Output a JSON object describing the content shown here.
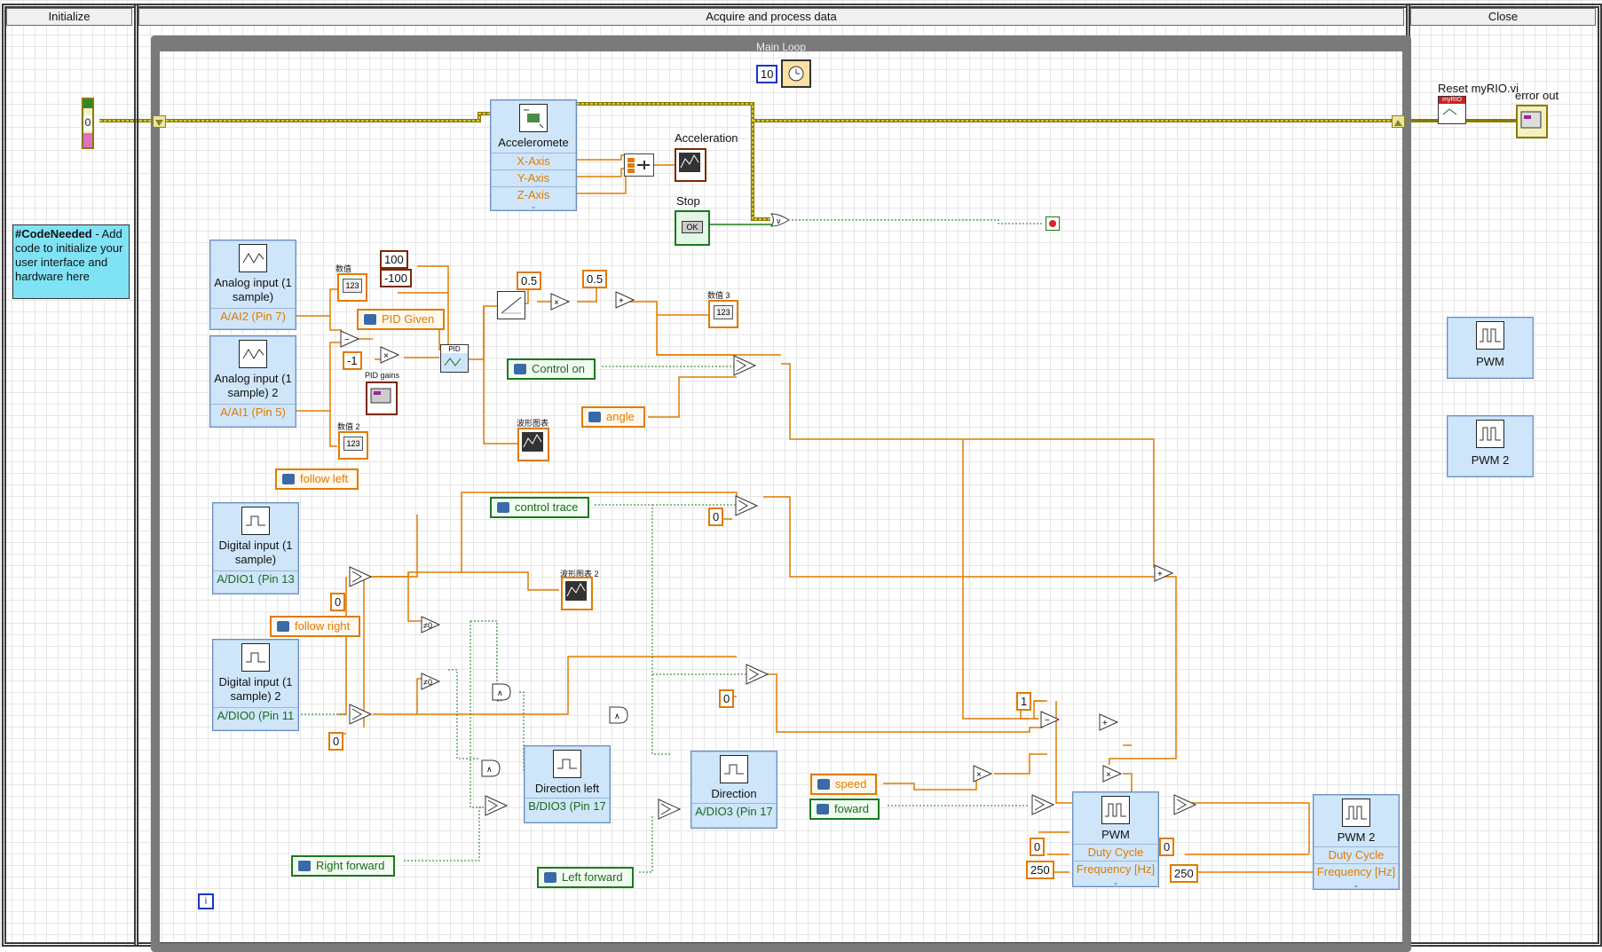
{
  "frames": {
    "initialize": "Initialize",
    "acquire": "Acquire and process data",
    "close": "Close"
  },
  "loop": {
    "title": "Main Loop",
    "wait_ms": "10",
    "iteration": "i"
  },
  "comment": {
    "tag": "#CodeNeeded",
    "text": " - Add code to initialize your user interface and hardware here"
  },
  "error_cluster": {
    "value": "0"
  },
  "accelerometer": {
    "title": "Acceleromete",
    "terms": [
      "X-Axis",
      "Y-Axis",
      "Z-Axis"
    ]
  },
  "acceleration_label": "Acceleration",
  "stop_label": "Stop",
  "stop_button_text": "OK",
  "constants": {
    "c100": "100",
    "cm100": "-100",
    "c05a": "0.5",
    "c05b": "0.5",
    "cm1": "-1",
    "c0a": "0",
    "c0b": "0",
    "c0c": "0",
    "c0d": "0",
    "c0e": "0",
    "c0f": "0",
    "c1": "1",
    "c250a": "250",
    "c250b": "250"
  },
  "analog1": {
    "title": "Analog input (1 sample)",
    "term": "A/AI2 (Pin 7)"
  },
  "analog2": {
    "title": "Analog input (1 sample) 2",
    "term": "A/AI1 (Pin 5)"
  },
  "digital1": {
    "title": "Digital input (1 sample)",
    "term": "A/DIO1 (Pin 13"
  },
  "digital2": {
    "title": "Digital input (1 sample) 2",
    "term": "A/DIO0 (Pin 11"
  },
  "dir_left": {
    "title": "Direction left",
    "term": "B/DIO3 (Pin 17"
  },
  "dir": {
    "title": "Direction",
    "term": "A/DIO3 (Pin 17"
  },
  "pwm1": {
    "title": "PWM",
    "terms": [
      "Duty Cycle",
      "Frequency [Hz]"
    ]
  },
  "pwm2": {
    "title": "PWM 2",
    "terms": [
      "Duty Cycle",
      "Frequency [Hz]"
    ]
  },
  "close_pwm1": "PWM",
  "close_pwm2": "PWM 2",
  "reset_label": "Reset myRIO.vi",
  "reset_badge": "myRIO",
  "error_out_label": "error out",
  "controls": {
    "pid_given": "PID Given",
    "control_on": "Control on",
    "angle": "angle",
    "follow_left": "follow left",
    "control_trace": "control trace",
    "follow_right": "follow right",
    "right_forward": "Right forward",
    "left_forward": "Left forward",
    "speed": "speed",
    "foward": "foward"
  },
  "indicators": {
    "num1_label": "数值",
    "num2_label": "数值 2",
    "num3_label": "数值 3",
    "wave1_label": "波形图表",
    "wave2_label": "波形图表 2",
    "pid_gains": "PID gains",
    "pid": "PID"
  },
  "colors": {
    "wire_orange": "#e07b00",
    "wire_green": "#1a7a1a",
    "error_wire": "#c8b400",
    "node_blue": "#cfe6fa"
  }
}
